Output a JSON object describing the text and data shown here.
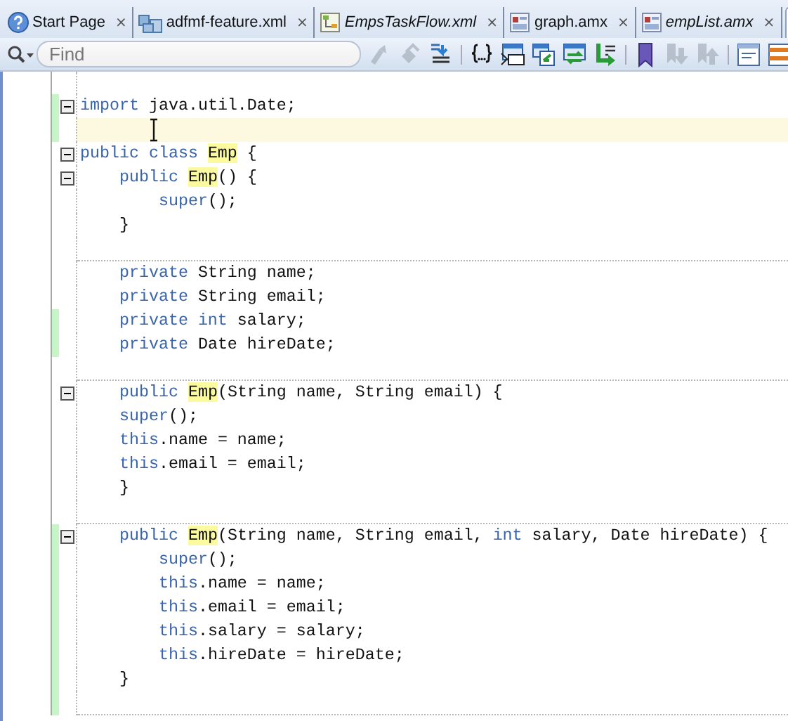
{
  "tabs": [
    {
      "kind": "help",
      "label": "Start Page",
      "close": "×",
      "italic": false,
      "selected": false
    },
    {
      "kind": "feature",
      "label": "adfmf-feature.xml",
      "close": "×",
      "italic": false,
      "selected": false
    },
    {
      "kind": "taskflow",
      "label": "EmpsTaskFlow.xml",
      "close": "×",
      "italic": true,
      "selected": false
    },
    {
      "kind": "amx",
      "label": "graph.amx",
      "close": "×",
      "italic": false,
      "selected": false
    },
    {
      "kind": "amx",
      "label": "empList.amx",
      "close": "×",
      "italic": true,
      "selected": false
    },
    {
      "kind": "stub",
      "selected": true
    }
  ],
  "toolbar": {
    "search": {
      "placeholder": "Find"
    },
    "buttons": [
      {
        "kind": "prev-occurrence",
        "disabled": true,
        "group_start": false
      },
      {
        "kind": "next-occurrence",
        "disabled": true,
        "group_start": false
      },
      {
        "kind": "indent",
        "disabled": false,
        "group_start": false
      },
      {
        "kind": "braces",
        "disabled": false,
        "group_start": true
      },
      {
        "kind": "window-numbers",
        "disabled": false,
        "group_start": false
      },
      {
        "kind": "window-back",
        "disabled": false,
        "group_start": false
      },
      {
        "kind": "window-swap",
        "disabled": false,
        "group_start": false
      },
      {
        "kind": "lines-arrow",
        "disabled": false,
        "group_start": false
      },
      {
        "kind": "bookmark",
        "disabled": false,
        "group_start": true
      },
      {
        "kind": "bookmark-down",
        "disabled": true,
        "group_start": false
      },
      {
        "kind": "bookmark-up",
        "disabled": true,
        "group_start": false
      },
      {
        "kind": "panel",
        "disabled": false,
        "group_start": true
      },
      {
        "kind": "panel-orange",
        "disabled": false,
        "group_start": false
      }
    ]
  },
  "editor": {
    "blocks": [
      {
        "lines": [
          {
            "fold": true,
            "changed": true,
            "current": false,
            "tokens": [
              {
                "kind": "keyword",
                "text": "import"
              },
              {
                "kind": "plain",
                "text": " java.util.Date;"
              }
            ]
          },
          {
            "fold": false,
            "changed": true,
            "current": true
          },
          {
            "fold": true,
            "changed": false,
            "current": false,
            "tokens": [
              {
                "kind": "keyword",
                "text": "public class "
              },
              {
                "kind": "match",
                "text": "Emp"
              },
              {
                "kind": "plain",
                "text": " {"
              }
            ]
          },
          {
            "fold": true,
            "changed": false,
            "current": false,
            "tokens": [
              {
                "kind": "keyword",
                "text": "    public "
              },
              {
                "kind": "match",
                "text": "Emp"
              },
              {
                "kind": "plain",
                "text": "() {"
              }
            ]
          },
          {
            "fold": false,
            "changed": false,
            "current": false,
            "tokens": [
              {
                "kind": "keyword",
                "text": "        super"
              },
              {
                "kind": "plain",
                "text": "();"
              }
            ]
          },
          {
            "fold": false,
            "changed": false,
            "current": false,
            "tokens": [
              {
                "kind": "plain",
                "text": "    }"
              }
            ]
          },
          {
            "fold": false,
            "changed": false,
            "current": false
          }
        ]
      },
      {
        "lines": [
          {
            "fold": false,
            "changed": false,
            "current": false,
            "tokens": [
              {
                "kind": "keyword",
                "text": "    private"
              },
              {
                "kind": "plain",
                "text": " String name;"
              }
            ]
          },
          {
            "fold": false,
            "changed": false,
            "current": false,
            "tokens": [
              {
                "kind": "keyword",
                "text": "    private"
              },
              {
                "kind": "plain",
                "text": " String email;"
              }
            ]
          },
          {
            "fold": false,
            "changed": true,
            "current": false,
            "tokens": [
              {
                "kind": "keyword",
                "text": "    private int"
              },
              {
                "kind": "plain",
                "text": " salary;"
              }
            ]
          },
          {
            "fold": false,
            "changed": true,
            "current": false,
            "tokens": [
              {
                "kind": "keyword",
                "text": "    private"
              },
              {
                "kind": "plain",
                "text": " Date hireDate;"
              }
            ]
          },
          {
            "fold": false,
            "changed": false,
            "current": false
          }
        ]
      },
      {
        "lines": [
          {
            "fold": true,
            "changed": false,
            "current": false,
            "tokens": [
              {
                "kind": "keyword",
                "text": "    public "
              },
              {
                "kind": "match",
                "text": "Emp"
              },
              {
                "kind": "plain",
                "text": "(String name, String email) {"
              }
            ]
          },
          {
            "fold": false,
            "changed": false,
            "current": false,
            "tokens": [
              {
                "kind": "keyword",
                "text": "    super"
              },
              {
                "kind": "plain",
                "text": "();"
              }
            ]
          },
          {
            "fold": false,
            "changed": false,
            "current": false,
            "tokens": [
              {
                "kind": "keyword",
                "text": "    this"
              },
              {
                "kind": "plain",
                "text": ".name = name;"
              }
            ]
          },
          {
            "fold": false,
            "changed": false,
            "current": false,
            "tokens": [
              {
                "kind": "keyword",
                "text": "    this"
              },
              {
                "kind": "plain",
                "text": ".email = email;"
              }
            ]
          },
          {
            "fold": false,
            "changed": false,
            "current": false,
            "tokens": [
              {
                "kind": "plain",
                "text": "    }"
              }
            ]
          },
          {
            "fold": false,
            "changed": false,
            "current": false
          }
        ]
      },
      {
        "lines": [
          {
            "fold": true,
            "changed": true,
            "current": false,
            "tokens": [
              {
                "kind": "keyword",
                "text": "    public "
              },
              {
                "kind": "match",
                "text": "Emp"
              },
              {
                "kind": "plain",
                "text": "(String name, String email, "
              },
              {
                "kind": "keyword",
                "text": "int"
              },
              {
                "kind": "plain",
                "text": " salary, Date hireDate) {"
              }
            ]
          },
          {
            "fold": false,
            "changed": true,
            "current": false,
            "tokens": [
              {
                "kind": "keyword",
                "text": "        super"
              },
              {
                "kind": "plain",
                "text": "();"
              }
            ]
          },
          {
            "fold": false,
            "changed": true,
            "current": false,
            "tokens": [
              {
                "kind": "keyword",
                "text": "        this"
              },
              {
                "kind": "plain",
                "text": ".name = name;"
              }
            ]
          },
          {
            "fold": false,
            "changed": true,
            "current": false,
            "tokens": [
              {
                "kind": "keyword",
                "text": "        this"
              },
              {
                "kind": "plain",
                "text": ".email = email;"
              }
            ]
          },
          {
            "fold": false,
            "changed": true,
            "current": false,
            "tokens": [
              {
                "kind": "keyword",
                "text": "        this"
              },
              {
                "kind": "plain",
                "text": ".salary = salary;"
              }
            ]
          },
          {
            "fold": false,
            "changed": true,
            "current": false,
            "tokens": [
              {
                "kind": "keyword",
                "text": "        this"
              },
              {
                "kind": "plain",
                "text": ".hireDate = hireDate;"
              }
            ]
          },
          {
            "fold": false,
            "changed": true,
            "current": false,
            "tokens": [
              {
                "kind": "plain",
                "text": "    }"
              }
            ]
          },
          {
            "fold": false,
            "changed": true,
            "current": false
          }
        ]
      }
    ]
  }
}
